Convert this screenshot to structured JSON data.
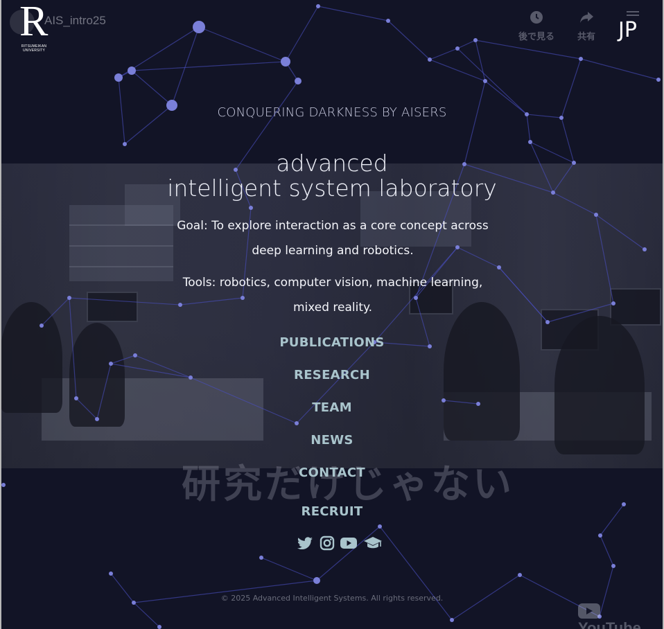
{
  "video": {
    "channel_title": "AIS_intro25",
    "watch_later_label": "後で見る",
    "share_label": "共有",
    "brand_label": "YouTube"
  },
  "logo": {
    "letter": "R",
    "subtext": "RITSUMEIKAN UNIVERSITY"
  },
  "language_toggle": "JP",
  "hero": {
    "tagline": "CONQUERING DARKNESS BY AISERS",
    "lab_name_line1": "advanced",
    "lab_name_line2": "intelligent system laboratory",
    "goal": "Goal: To explore interaction as a core concept across deep learning and robotics.",
    "tools": "Tools: robotics, computer vision, machine learning, mixed reality.",
    "background_caption": "研究だけじゃない"
  },
  "nav": {
    "items": [
      "PUBLICATIONS",
      "RESEARCH",
      "TEAM",
      "NEWS",
      "CONTACT",
      "RECRUIT"
    ]
  },
  "social": {
    "icons": [
      "twitter-icon",
      "instagram-icon",
      "youtube-icon",
      "graduation-cap-icon"
    ]
  },
  "footer": {
    "copyright": "© 2025 Advanced Intelligent Systems. All rights reserved."
  },
  "colors": {
    "background": "#121426",
    "network": "#4a4fc0",
    "nav_link": "#a9c4cc",
    "text": "#f4f5fa"
  }
}
